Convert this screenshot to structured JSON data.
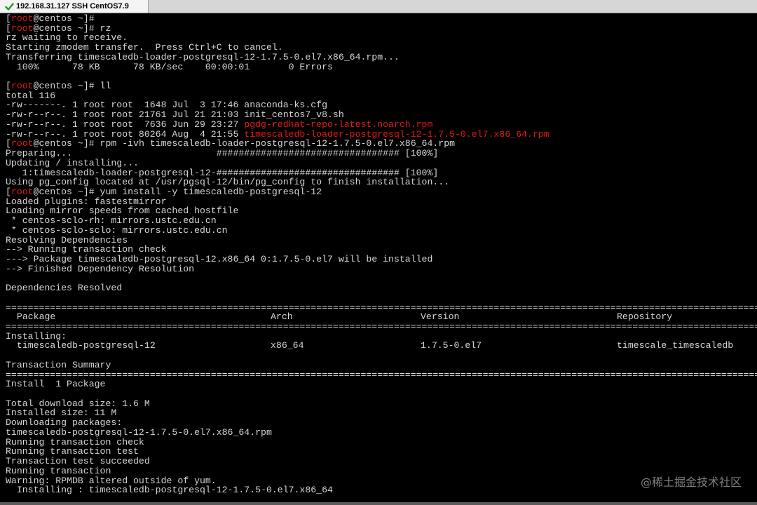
{
  "tab": {
    "title": "192.168.31.127 SSH CentOS7.9"
  },
  "terminal": {
    "lines": [
      {
        "parts": [
          {
            "t": "[",
            "c": ""
          },
          {
            "t": "root",
            "c": "red"
          },
          {
            "t": "@centos ~]#",
            "c": ""
          }
        ]
      },
      {
        "parts": [
          {
            "t": "[",
            "c": ""
          },
          {
            "t": "root",
            "c": "red"
          },
          {
            "t": "@centos ~]# rz",
            "c": ""
          }
        ]
      },
      {
        "parts": [
          {
            "t": "rz waiting to receive.",
            "c": ""
          }
        ]
      },
      {
        "parts": [
          {
            "t": "Starting zmodem transfer.  Press Ctrl+C to cancel.",
            "c": ""
          }
        ]
      },
      {
        "parts": [
          {
            "t": "Transferring timescaledb-loader-postgresql-12-1.7.5-0.el7.x86_64.rpm...",
            "c": ""
          }
        ]
      },
      {
        "parts": [
          {
            "t": "  100%      78 KB      78 KB/sec    00:00:01       0 Errors",
            "c": ""
          }
        ]
      },
      {
        "parts": [
          {
            "t": "",
            "c": ""
          }
        ]
      },
      {
        "parts": [
          {
            "t": "[",
            "c": ""
          },
          {
            "t": "root",
            "c": "red"
          },
          {
            "t": "@centos ~]# ll",
            "c": ""
          }
        ]
      },
      {
        "parts": [
          {
            "t": "total 116",
            "c": ""
          }
        ]
      },
      {
        "parts": [
          {
            "t": "-rw-------. 1 root root  1648 Jul  3 17:46 anaconda-ks.cfg",
            "c": ""
          }
        ]
      },
      {
        "parts": [
          {
            "t": "-rw-r--r--. 1 root root 21761 Jul 21 21:03 init_centos7_v8.sh",
            "c": ""
          }
        ]
      },
      {
        "parts": [
          {
            "t": "-rw-r--r--. 1 root root  7636 Jun 29 23:27 ",
            "c": ""
          },
          {
            "t": "pgdg-redhat-repo-latest.noarch.rpm",
            "c": "red"
          }
        ]
      },
      {
        "parts": [
          {
            "t": "-rw-r--r--. 1 root root 80264 Aug  4 21:55 ",
            "c": ""
          },
          {
            "t": "timescaledb-loader-postgresql-12-1.7.5-0.el7.x86_64.rpm",
            "c": "red"
          }
        ]
      },
      {
        "parts": [
          {
            "t": "[",
            "c": ""
          },
          {
            "t": "root",
            "c": "red"
          },
          {
            "t": "@centos ~]# rpm -ivh timescaledb-loader-postgresql-12-1.7.5-0.el7.x86_64.rpm",
            "c": ""
          }
        ]
      },
      {
        "parts": [
          {
            "t": "Preparing...                          ################################# [100%]",
            "c": ""
          }
        ]
      },
      {
        "parts": [
          {
            "t": "Updating / installing...",
            "c": ""
          }
        ]
      },
      {
        "parts": [
          {
            "t": "   1:timescaledb-loader-postgresql-12-################################# [100%]",
            "c": ""
          }
        ]
      },
      {
        "parts": [
          {
            "t": "Using pg_config located at /usr/pgsql-12/bin/pg_config to finish installation...",
            "c": ""
          }
        ]
      },
      {
        "parts": [
          {
            "t": "[",
            "c": ""
          },
          {
            "t": "root",
            "c": "red"
          },
          {
            "t": "@centos ~]# yum install -y timescaledb-postgresql-12",
            "c": ""
          }
        ]
      },
      {
        "parts": [
          {
            "t": "Loaded plugins: fastestmirror",
            "c": ""
          }
        ]
      },
      {
        "parts": [
          {
            "t": "Loading mirror speeds from cached hostfile",
            "c": ""
          }
        ]
      },
      {
        "parts": [
          {
            "t": " * centos-sclo-rh: mirrors.ustc.edu.cn",
            "c": ""
          }
        ]
      },
      {
        "parts": [
          {
            "t": " * centos-sclo-sclo: mirrors.ustc.edu.cn",
            "c": ""
          }
        ]
      },
      {
        "parts": [
          {
            "t": "Resolving Dependencies",
            "c": ""
          }
        ]
      },
      {
        "parts": [
          {
            "t": "--> Running transaction check",
            "c": ""
          }
        ]
      },
      {
        "parts": [
          {
            "t": "---> Package timescaledb-postgresql-12.x86_64 0:1.7.5-0.el7 will be installed",
            "c": ""
          }
        ]
      },
      {
        "parts": [
          {
            "t": "--> Finished Dependency Resolution",
            "c": ""
          }
        ]
      },
      {
        "parts": [
          {
            "t": "",
            "c": ""
          }
        ]
      },
      {
        "parts": [
          {
            "t": "Dependencies Resolved",
            "c": ""
          }
        ]
      },
      {
        "parts": [
          {
            "t": "",
            "c": ""
          }
        ]
      }
    ],
    "table": {
      "separator_char": "=",
      "headers": [
        " Package",
        "Arch",
        "Version",
        "Repository"
      ],
      "installing_label": "Installing:",
      "row": [
        " timescaledb-postgresql-12",
        "x86_64",
        "1.7.5-0.el7",
        "timescale_timescaledb"
      ]
    },
    "tail_lines": [
      "",
      "Transaction Summary",
      "=SEP=",
      "Install  1 Package",
      "",
      "Total download size: 1.6 M",
      "Installed size: 11 M",
      "Downloading packages:",
      "timescaledb-postgresql-12-1.7.5-0.el7.x86_64.rpm",
      "Running transaction check",
      "Running transaction test",
      "Transaction test succeeded",
      "Running transaction",
      "Warning: RPMDB altered outside of yum.",
      "  Installing : timescaledb-postgresql-12-1.7.5-0.el7.x86_64"
    ]
  },
  "watermark": "@稀土掘金技术社区"
}
